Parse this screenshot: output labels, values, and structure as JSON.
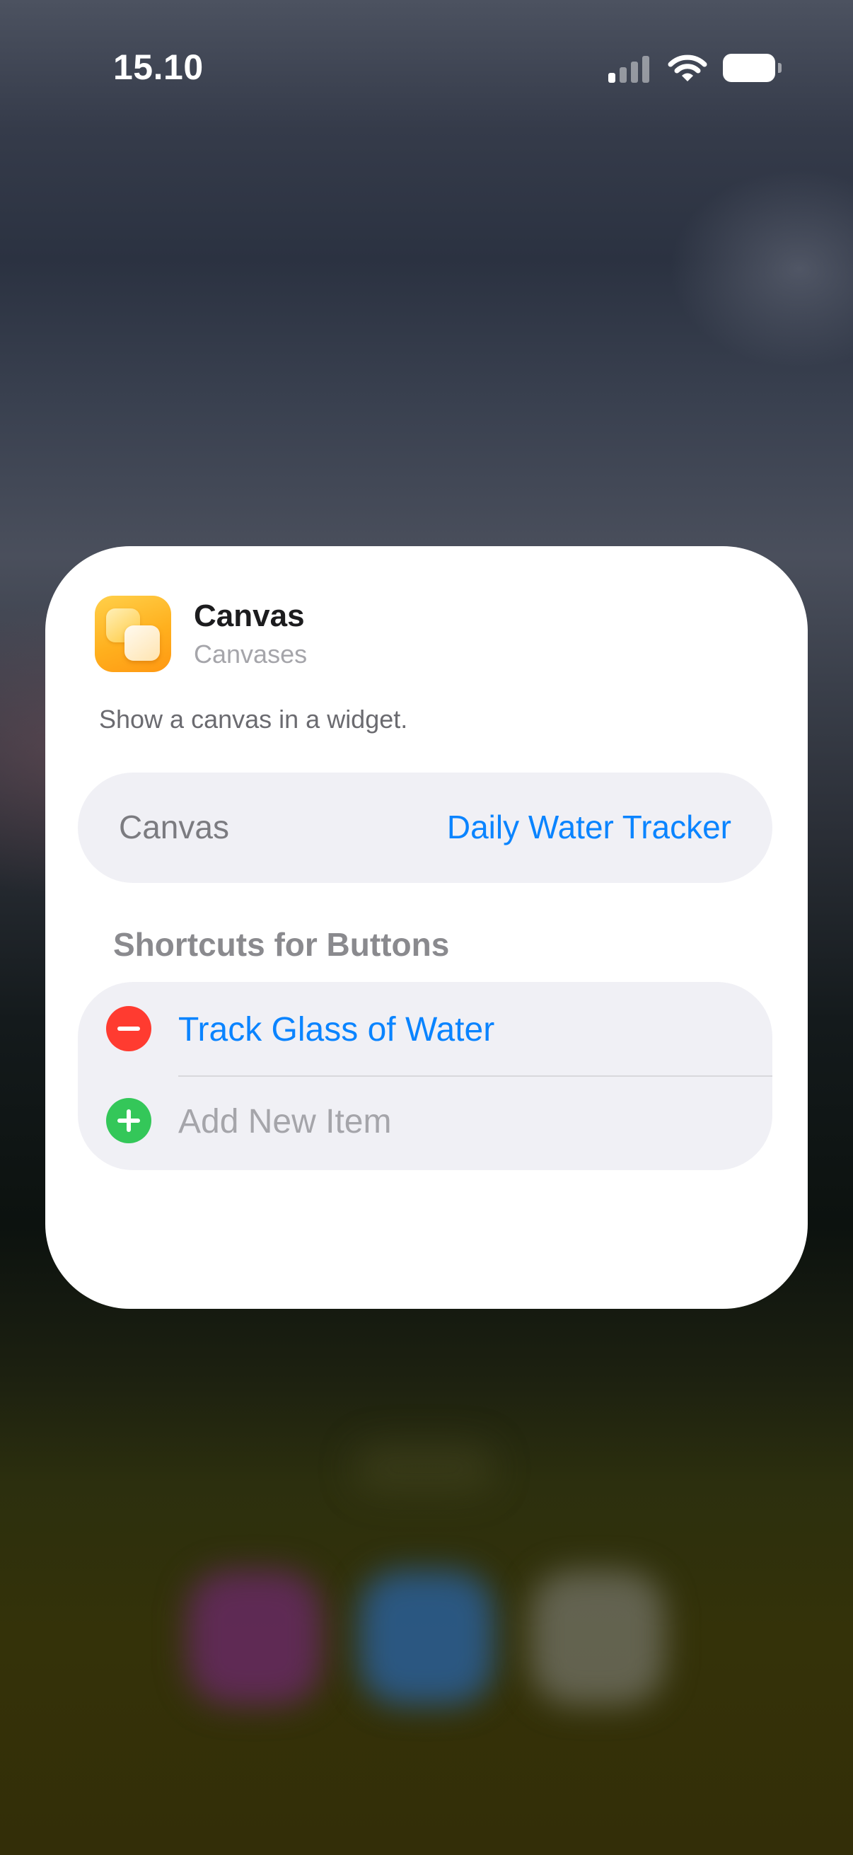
{
  "status_bar": {
    "time": "15.10",
    "icons": [
      "cellular-signal-icon",
      "wifi-icon",
      "battery-icon"
    ]
  },
  "widget_config": {
    "app_name": "Canvas",
    "app_subtitle": "Canvases",
    "app_icon": "canvas-app-icon",
    "description": "Show a canvas in a widget.",
    "parameter": {
      "label": "Canvas",
      "value": "Daily Water Tracker"
    },
    "shortcuts_section": {
      "header": "Shortcuts for Buttons",
      "items": [
        {
          "label": "Track Glass of Water",
          "action_icon": "remove-circle-icon"
        }
      ],
      "add_item_label": "Add New Item",
      "add_icon": "add-circle-icon"
    }
  },
  "colors": {
    "accent": "#0a84ff",
    "remove": "#ff3b30",
    "add": "#34c759",
    "card_background": "#ffffff",
    "row_background": "#f0f0f5"
  }
}
